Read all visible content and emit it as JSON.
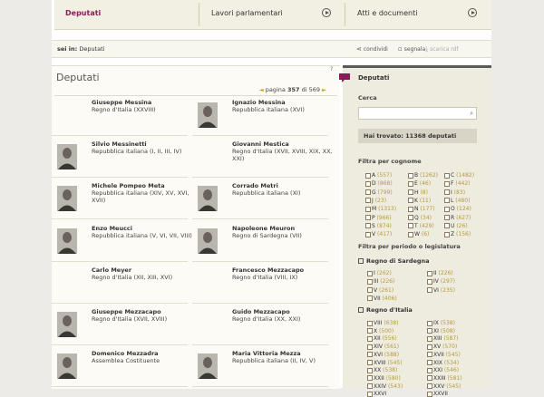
{
  "nav": {
    "tabs": [
      {
        "label": "Deputati",
        "active": true
      },
      {
        "label": "Lavori parlamentari",
        "active": false
      },
      {
        "label": "Atti e documenti",
        "active": false
      }
    ]
  },
  "breadcrumb": {
    "prefix": "sei in:",
    "current": "Deputati"
  },
  "tools": {
    "share": "condividi",
    "report": "segnala",
    "download": "scarica rdf"
  },
  "main": {
    "title": "Deputati",
    "help": "?",
    "pager": {
      "prev": "◄",
      "word": "pagina",
      "current": "357",
      "of": "di",
      "total": "569",
      "next": "►"
    },
    "deputies": [
      {
        "name": "Giuseppe Messina",
        "lines": [
          "Regno d'Italia (XXVIII)"
        ],
        "photo": false
      },
      {
        "name": "Ignazio Messina",
        "lines": [
          "Repubblica italiana (XVI)"
        ],
        "photo": true
      },
      {
        "name": "Silvio Messinetti",
        "lines": [
          "Repubblica italiana (I, II, III, IV)"
        ],
        "photo": true
      },
      {
        "name": "Giovanni Mestica",
        "lines": [
          "Regno d'Italia (XVII, XVIII, XIX, XX,",
          "XXI)"
        ],
        "photo": false
      },
      {
        "name": "Michele Pompeo Meta",
        "lines": [
          "Repubblica italiana (XIV, XV, XVI,",
          "XVII)"
        ],
        "photo": true
      },
      {
        "name": "Corrado Metri",
        "lines": [
          "Repubblica italiana (XI)"
        ],
        "photo": true
      },
      {
        "name": "Enzo Meucci",
        "lines": [
          "Repubblica italiana (V, VI, VII, VIII)"
        ],
        "photo": true
      },
      {
        "name": "Napoleone Meuron",
        "lines": [
          "Regno di Sardegna (VII)"
        ],
        "photo": true
      },
      {
        "name": "Carlo Meyer",
        "lines": [
          "Regno d'Italia (XII, XIII, XVI)"
        ],
        "photo": false
      },
      {
        "name": "Francesco Mezzacapo",
        "lines": [
          "Regno d'Italia (VIII, IX)"
        ],
        "photo": false
      },
      {
        "name": "Giuseppe Mezzacapo",
        "lines": [
          "Regno d'Italia (XVII, XVIII)"
        ],
        "photo": true
      },
      {
        "name": "Guido Mezzacapo",
        "lines": [
          "Regno d'Italia (XX, XXI)"
        ],
        "photo": false
      },
      {
        "name": "Domenico Mezzadra",
        "lines": [
          "Assemblea Costituente"
        ],
        "photo": true
      },
      {
        "name": "Maria Vittoria Mezza",
        "lines": [
          "Repubblica italiana (II, IV, V)"
        ],
        "photo": true
      }
    ]
  },
  "sidebar": {
    "title": "Deputati",
    "search_label": "Cerca",
    "search_value": "",
    "search_placeholder": "",
    "found": "Hai trovato: 11368 deputati",
    "surname_filter": "Filtra per cognome",
    "letters": [
      [
        "A",
        "557"
      ],
      [
        "B",
        "1262"
      ],
      [
        "C",
        "1482"
      ],
      [
        "D",
        "868"
      ],
      [
        "E",
        "46"
      ],
      [
        "F",
        "442"
      ],
      [
        "G",
        "799"
      ],
      [
        "H",
        "8"
      ],
      [
        "I",
        "83"
      ],
      [
        "J",
        "23"
      ],
      [
        "K",
        "11"
      ],
      [
        "L",
        "480"
      ],
      [
        "M",
        "1313"
      ],
      [
        "N",
        "177"
      ],
      [
        "O",
        "124"
      ],
      [
        "P",
        "966"
      ],
      [
        "Q",
        "34"
      ],
      [
        "R",
        "627"
      ],
      [
        "S",
        "874"
      ],
      [
        "T",
        "429"
      ],
      [
        "U",
        "26"
      ],
      [
        "V",
        "417"
      ],
      [
        "W",
        "6"
      ],
      [
        "Z",
        "156"
      ]
    ],
    "period_filter": "Filtra per periodo o legislatura",
    "sardegna_label": "Regno di Sardegna",
    "sardegna": [
      [
        "I",
        "262"
      ],
      [
        "II",
        "226"
      ],
      [
        "III",
        "226"
      ],
      [
        "IV",
        "297"
      ],
      [
        "V",
        "261"
      ],
      [
        "VI",
        "235"
      ],
      [
        "VII",
        "406"
      ]
    ],
    "italia_label": "Regno d'Italia",
    "italia": [
      [
        "VIII",
        "638"
      ],
      [
        "IX",
        "538"
      ],
      [
        "X",
        "500"
      ],
      [
        "XI",
        "508"
      ],
      [
        "XII",
        "556"
      ],
      [
        "XIII",
        "587"
      ],
      [
        "XIV",
        "561"
      ],
      [
        "XV",
        "570"
      ],
      [
        "XVI",
        "588"
      ],
      [
        "XVII",
        "545"
      ],
      [
        "XVIII",
        "545"
      ],
      [
        "XIX",
        "534"
      ],
      [
        "XX",
        "538"
      ],
      [
        "XXI",
        "546"
      ],
      [
        "XXII",
        "580"
      ],
      [
        "XXIII",
        "581"
      ],
      [
        "XXIV",
        "543"
      ],
      [
        "XXV",
        "545"
      ],
      [
        "XXVI",
        "",
        ""
      ],
      [
        "XXVII",
        "",
        ""
      ]
    ]
  }
}
